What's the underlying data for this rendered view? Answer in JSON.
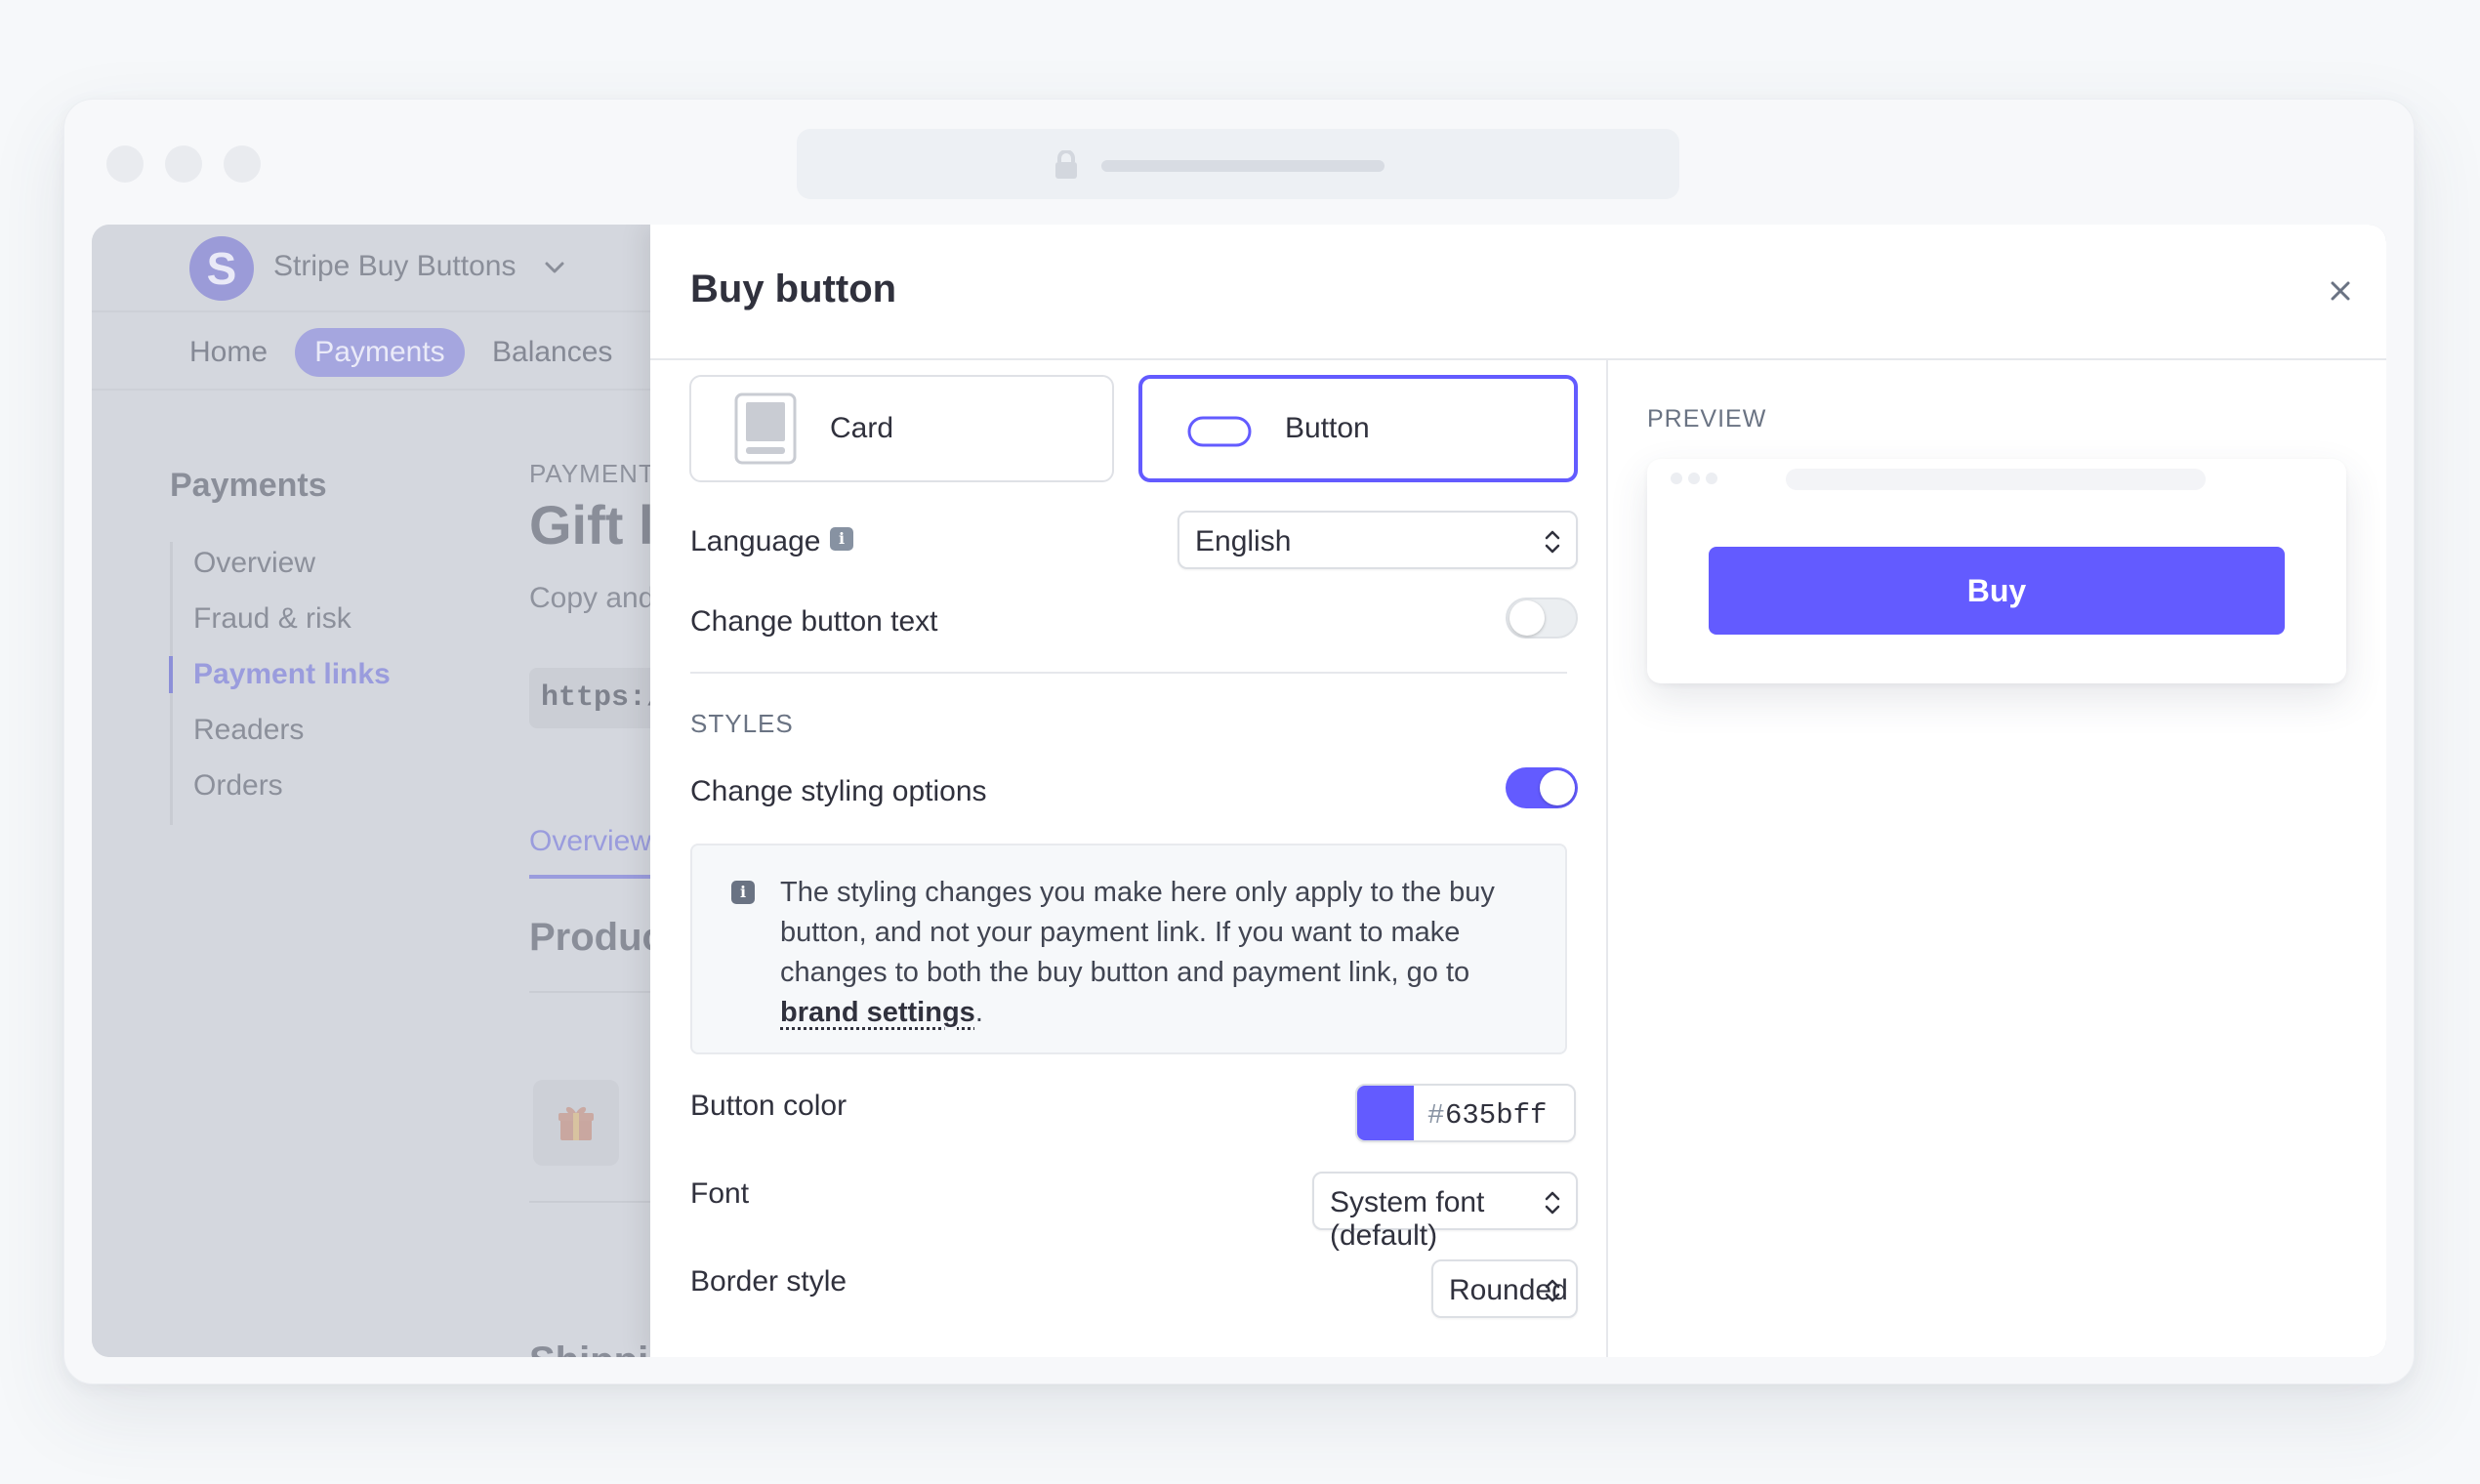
{
  "background_app": {
    "account_logo_letter": "S",
    "account_name": "Stripe Buy Buttons",
    "nav": [
      "Home",
      "Payments",
      "Balances"
    ],
    "sidebar_title": "Payments",
    "sidebar_items": [
      "Overview",
      "Fraud & risk",
      "Payment links",
      "Readers",
      "Orders"
    ],
    "breadcrumb": "PAYMENT",
    "page_title": "Gift l",
    "subtitle": "Copy and",
    "code_snippet": "https:/",
    "tab": "Overview",
    "section_heading": "Produc",
    "section_heading_2": "Shippi"
  },
  "panel": {
    "title": "Buy button",
    "type_options": {
      "card": "Card",
      "button": "Button",
      "selected": "button"
    },
    "language": {
      "label": "Language",
      "value": "English"
    },
    "change_button_text": {
      "label": "Change button text",
      "enabled": false
    },
    "styles": {
      "section_title": "STYLES",
      "change_styling": {
        "label": "Change styling options",
        "enabled": true
      },
      "notice": {
        "text": "The styling changes you make here only apply to the buy button, and not your payment link. If you want to make changes to both the buy button and payment link, go to ",
        "link": "brand settings",
        "after": "."
      },
      "button_color": {
        "label": "Button color",
        "hash": "#",
        "value": "635bff",
        "swatch": "#635bff"
      },
      "font": {
        "label": "Font",
        "value": "System font (default)"
      },
      "border_style": {
        "label": "Border style",
        "value": "Rounded"
      }
    },
    "preview": {
      "title": "PREVIEW",
      "buy_label": "Buy",
      "button_color": "#635bff"
    }
  },
  "colors": {
    "accent": "#635bff",
    "text": "#30313d",
    "muted": "#6a7383"
  }
}
